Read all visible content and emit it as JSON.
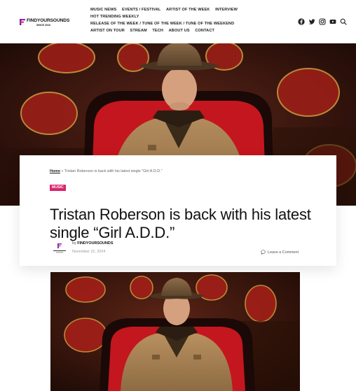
{
  "brand": {
    "logo_text": "FINDYOURSOUNDS",
    "logo_sub": "SINCE 2016",
    "accent_color": "#d8246e"
  },
  "nav": {
    "row1": [
      "Music News",
      "Events / Festival",
      "Artist of the Week",
      "Interview"
    ],
    "row2": [
      "Hot Trending Weekly"
    ],
    "row3": [
      "Release of the Week / Tune of the Week / Tune of the Weekend"
    ],
    "row4": [
      "Artist on Tour",
      "Stream",
      "Tech",
      "About Us",
      "Contact"
    ]
  },
  "socials": [
    "facebook-icon",
    "twitter-icon",
    "instagram-icon",
    "youtube-icon",
    "search-icon"
  ],
  "article": {
    "breadcrumb_home": "Home",
    "breadcrumb_sep": "»",
    "breadcrumb_current": "Tristan Roberson is back with his latest single \"Girl A.D.D.\"",
    "tag": "MUSIC",
    "title": "Tristan Roberson is back with his latest single “Girl A.D.D.”",
    "byline_prefix": "by",
    "author": "FINDYOURSOUNDS",
    "date": "November 22, 2024",
    "comments": "Leave a Comment"
  }
}
